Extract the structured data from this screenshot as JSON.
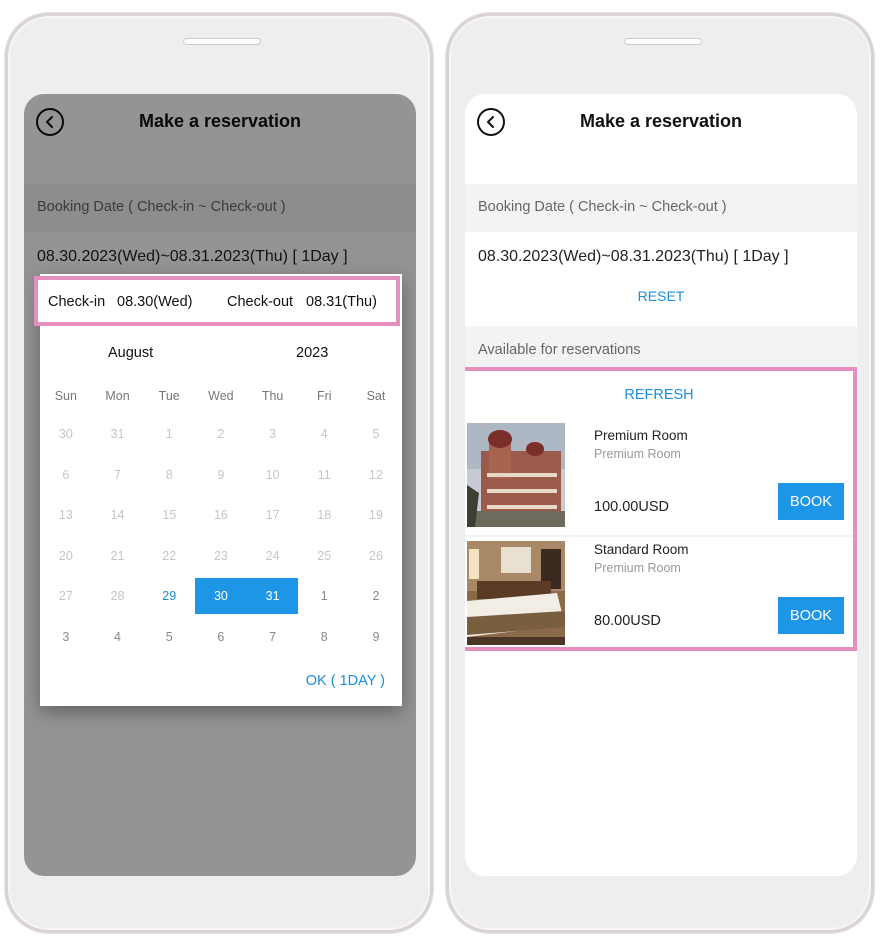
{
  "left_screen": {
    "title": "Make a reservation",
    "booking_label": "Booking Date ( Check-in ~ Check-out )",
    "date_range": "08.30.2023(Wed)~08.31.2023(Thu) [ 1Day ]",
    "calendar": {
      "checkin_label": "Check-in",
      "checkin_value": "08.30(Wed)",
      "checkout_label": "Check-out",
      "checkout_value": "08.31(Thu)",
      "month": "August",
      "year": "2023",
      "weekdays": [
        "Sun",
        "Mon",
        "Tue",
        "Wed",
        "Thu",
        "Fri",
        "Sat"
      ],
      "weeks": [
        [
          "30",
          "31",
          "1",
          "2",
          "3",
          "4",
          "5"
        ],
        [
          "6",
          "7",
          "8",
          "9",
          "10",
          "11",
          "12"
        ],
        [
          "13",
          "14",
          "15",
          "16",
          "17",
          "18",
          "19"
        ],
        [
          "20",
          "21",
          "22",
          "23",
          "24",
          "25",
          "26"
        ],
        [
          "27",
          "28",
          "29",
          "30",
          "31",
          "1",
          "2"
        ],
        [
          "3",
          "4",
          "5",
          "6",
          "7",
          "8",
          "9"
        ]
      ],
      "ok_label": "OK ( 1DAY )",
      "selected_color": "#1e96e8",
      "highlight_color": "#e58fbf"
    }
  },
  "right_screen": {
    "title": "Make a reservation",
    "booking_label": "Booking Date ( Check-in ~ Check-out )",
    "date_range": "08.30.2023(Wed)~08.31.2023(Thu) [ 1Day ]",
    "reset_label": "RESET",
    "available_label": "Available for reservations",
    "refresh_label": "REFRESH",
    "rooms": [
      {
        "name": "Premium Room",
        "subtitle": "Premium Room",
        "price": "100.00USD",
        "book_label": "BOOK"
      },
      {
        "name": "Standard Room",
        "subtitle": "Premium Room",
        "price": "80.00USD",
        "book_label": "BOOK"
      }
    ]
  },
  "icons": {
    "back": "chevron-left-circle-icon"
  },
  "colors": {
    "accent": "#1a8fdc",
    "button": "#1e96e8",
    "highlight": "#e58fbf"
  }
}
